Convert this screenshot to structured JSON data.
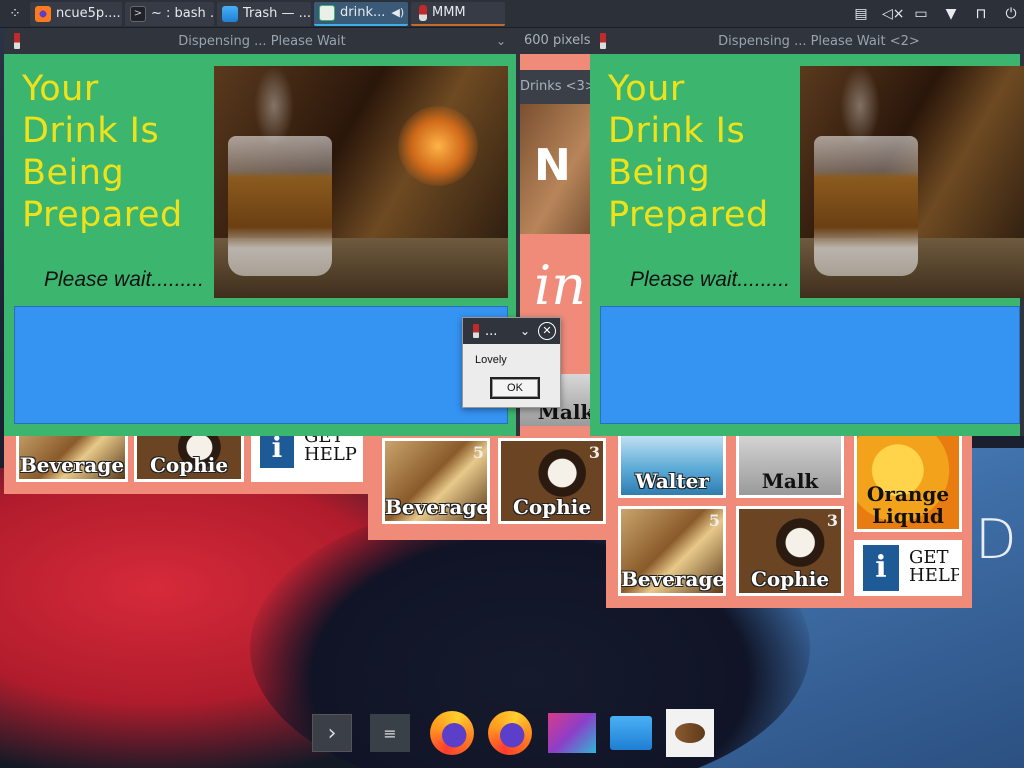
{
  "taskbar": {
    "tasks": [
      {
        "label": "ncue5p....",
        "icon": "firefox-icon"
      },
      {
        "label": "~ : bash ...",
        "icon": "terminal-icon"
      },
      {
        "label": "Trash — ...",
        "icon": "folder-icon"
      },
      {
        "label": "drink...",
        "icon": "drink-app-icon",
        "active": true
      },
      {
        "label": "MMM",
        "icon": "wine-glass-icon"
      }
    ],
    "tray_icons": [
      "clipboard-icon",
      "volume-muted-icon",
      "network-icon",
      "expand-arrow-icon",
      "lock-icon",
      "power-icon"
    ]
  },
  "background_window": {
    "title_fragment": "600 pixels)",
    "title_fragment2": "Drinks <3>",
    "tiles_row1_left": [
      {
        "label": "Beverage"
      },
      {
        "label": "Cophie"
      },
      {
        "label": "GET HELP"
      }
    ],
    "tiles_mid": [
      {
        "label": "Beverage",
        "number": "5"
      },
      {
        "label": "Cophie",
        "number": "3"
      }
    ],
    "tile_top_partial": "Malk",
    "tiles_right": [
      {
        "label": "Walter"
      },
      {
        "label": "Malk"
      },
      {
        "label": "Orange Liquid"
      },
      {
        "label": "Beverage",
        "number": "5"
      },
      {
        "label": "Cophie",
        "number": "3"
      },
      {
        "label": "GET HELP"
      }
    ]
  },
  "dispense_windows": [
    {
      "title": "Dispensing ... Please Wait",
      "heading": [
        "Your",
        "Drink Is",
        "Being",
        "Prepared"
      ],
      "wait_text": "Please wait........."
    },
    {
      "title": "Dispensing ... Please Wait <2>",
      "heading": [
        "Your",
        "Drink Is",
        "Being",
        "Prepared"
      ],
      "wait_text": "Please wait........."
    }
  ],
  "message_dialog": {
    "title": "...",
    "message": "Lovely",
    "ok_label": "OK"
  },
  "colors": {
    "window_green": "#3cb66f",
    "heading_yellow": "#f0e21a",
    "progress_blue": "#3593f2",
    "salmon": "#f08b7a",
    "titlebar": "#2f343d"
  },
  "dock": {
    "items": [
      "terminal-icon",
      "mixer-icon",
      "firefox-icon",
      "firefox-icon",
      "kde-connect-icon",
      "folder-icon",
      "coffee-bean-icon"
    ]
  }
}
